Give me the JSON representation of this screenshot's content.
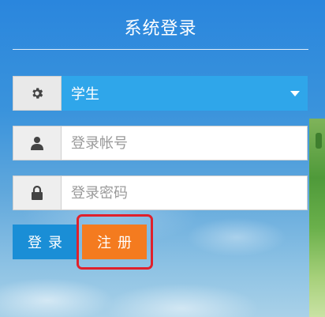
{
  "form": {
    "title": "系统登录",
    "role": {
      "icon": "gear-icon",
      "selected": "学生"
    },
    "account": {
      "icon": "user-icon",
      "placeholder": "登录帐号"
    },
    "password": {
      "icon": "lock-icon",
      "placeholder": "登录密码"
    },
    "login_label": "登录",
    "register_label": "注册"
  },
  "colors": {
    "select_bg": "#2fa6ea",
    "login_bg": "#1a8ed6",
    "register_bg": "#f47b1f",
    "highlight_border": "#e0202b"
  }
}
